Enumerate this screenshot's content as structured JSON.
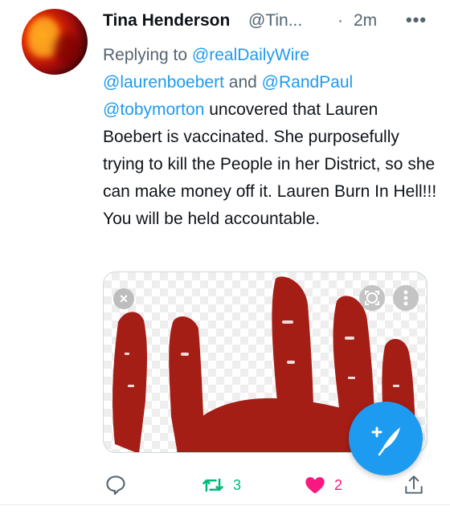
{
  "tweet": {
    "author_name": "Tina Henderson",
    "author_handle": "@Tin...",
    "separator": "·",
    "time": "2m",
    "replying_prefix": "Replying to",
    "replying_to": [
      "@realDailyWire",
      "@laurenboebert",
      "@RandPaul"
    ],
    "replying_and": "and",
    "body_mention": "@tobymorton",
    "body_text": " uncovered that Lauren Boebert is vaccinated. She purposefully trying to kill the People in her District, so she can make money off it. Lauren Burn In Hell!!! You will be held accountable."
  },
  "media": {
    "close_glyph": "×"
  },
  "actions": {
    "retweet_count": "3",
    "like_count": "2"
  },
  "colors": {
    "accent": "#1d9bf0",
    "retweet": "#00ba7c",
    "like": "#f91880",
    "hand": "#a51e16"
  }
}
